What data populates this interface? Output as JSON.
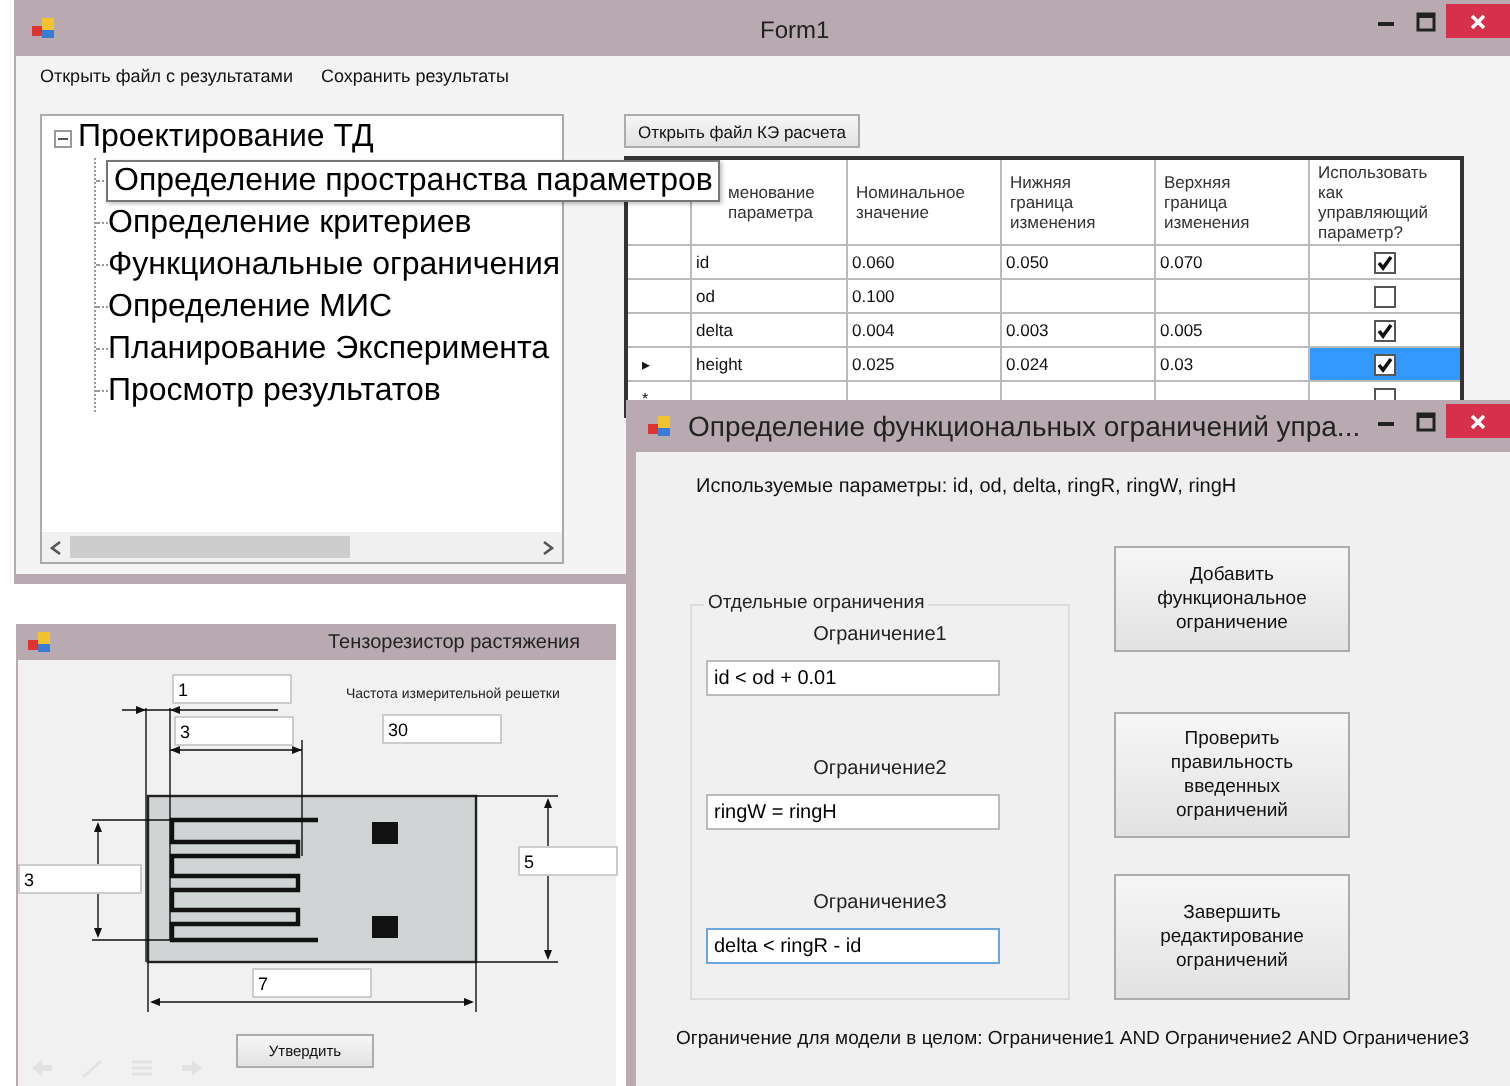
{
  "main_window": {
    "title": "Form1",
    "menu": [
      "Открыть файл с результатами",
      "Сохранить результаты"
    ],
    "tree": {
      "root": {
        "label": "Проектирование ТД",
        "expanded": true,
        "children": [
          {
            "label": "Определение пространства параметров",
            "hovered": true
          },
          {
            "label": "Определение критериев",
            "hovered": false
          },
          {
            "label": "Функциональные ограничения",
            "hovered": false
          },
          {
            "label": "Определение МИС",
            "hovered": false
          },
          {
            "label": "Планирование Эксперимента",
            "hovered": false
          },
          {
            "label": "Просмотр результатов",
            "hovered": false
          }
        ]
      }
    },
    "open_button": "Открыть файл КЭ расчета",
    "table": {
      "columns": [
        "менование\nпараметра",
        "Номинальное\nзначение",
        "Нижняя\nграница\nизменения",
        "Верхняя\nграница\nизменения",
        "Использовать\nкак\nуправляющий\nпараметр?"
      ],
      "rows": [
        {
          "name": "id",
          "nominal": "0.060",
          "lower": "0.050",
          "upper": "0.070",
          "use_as_control": true,
          "selected": false
        },
        {
          "name": "od",
          "nominal": "0.100",
          "use_as_control": false,
          "selected": false
        },
        {
          "name": "delta",
          "nominal": "0.004",
          "lower": "0.003",
          "upper": "0.005",
          "use_as_control": true,
          "selected": false
        },
        {
          "marker": "▸",
          "name": "height",
          "nominal": "0.025",
          "lower": "0.024",
          "upper": "0.03",
          "use_as_control": true,
          "selected": true
        },
        {
          "marker": "*",
          "use_as_control": false,
          "selected": false
        }
      ]
    }
  },
  "gauge_window": {
    "title": "Тензорезистор растяжения",
    "frequency_label": "Частота измерительной решетки",
    "fields": [
      "1",
      "3",
      "30",
      "3",
      "5",
      "7"
    ],
    "button": "Утвердить"
  },
  "constraints_window": {
    "title": "Определение функциональных ограничений упра...",
    "params_text": "Используемые параметры: id, od, delta, ringR, ringW, ringH",
    "group": {
      "legend": "Отдельные ограничения",
      "constraints": [
        {
          "label": "Ограничение1",
          "value": "id < od + 0.01",
          "focused": false
        },
        {
          "label": "Ограничение2",
          "value": "ringW = ringH",
          "focused": false
        },
        {
          "label": "Ограничение3",
          "value": "delta < ringR - id",
          "focused": true
        }
      ]
    },
    "buttons": [
      "Добавить\nфункциональное\nограничение",
      "Проверить\nправильность\nвведенных\nограничений",
      "Завершить\nредактирование\nограничений"
    ],
    "model_text": "Ограничение для модели в целом: Ограничение1 AND Ограничение2 AND Ограничение3"
  }
}
